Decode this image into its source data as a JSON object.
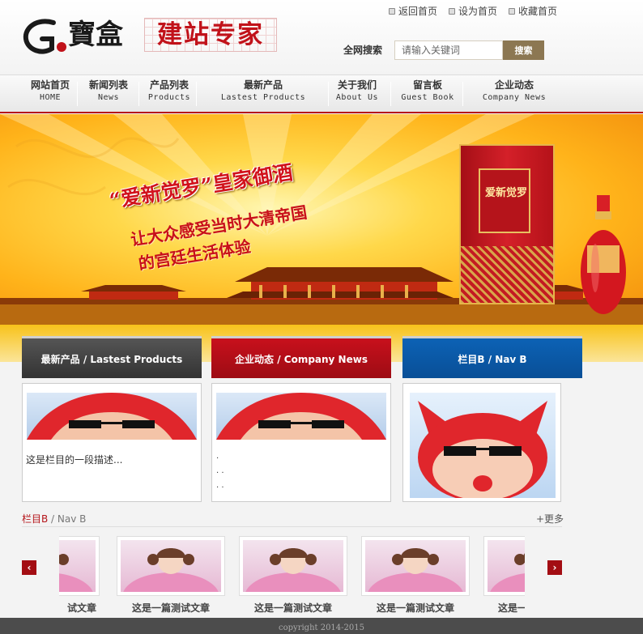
{
  "header": {
    "logo_text": "建站专家",
    "logo_brand": "G寶盒",
    "top_links": [
      {
        "label": "返回首页",
        "icon": "home-icon"
      },
      {
        "label": "设为首页",
        "icon": "home-icon"
      },
      {
        "label": "收藏首页",
        "icon": "home-icon"
      }
    ],
    "search": {
      "label": "全网搜索",
      "placeholder": "请输入关键词",
      "button": "搜索"
    }
  },
  "nav": [
    {
      "cn": "网站首页",
      "en": "HOME"
    },
    {
      "cn": "新闻列表",
      "en": "News"
    },
    {
      "cn": "产品列表",
      "en": "Products"
    },
    {
      "cn": "最新产品",
      "en": "Lastest Products"
    },
    {
      "cn": "关于我们",
      "en": "About Us"
    },
    {
      "cn": "留言板",
      "en": "Guest Book"
    },
    {
      "cn": "企业动态",
      "en": "Company News"
    }
  ],
  "banner": {
    "title": "“爱新觉罗”皇家御酒",
    "line1": "让大众感受当时大清帝国",
    "line2": "的宫廷生活体验",
    "product_label": "爱新觉罗"
  },
  "columns": [
    {
      "title": "最新产品 / Lastest Products",
      "desc": "这是栏目的一段描述..."
    },
    {
      "title": "企业动态 / Company News",
      "dots": [
        ".",
        ". .",
        ". ."
      ]
    },
    {
      "title": "栏目B / Nav B"
    }
  ],
  "section_b": {
    "title_a": "栏目B",
    "title_b": " / Nav B",
    "more": "+更多",
    "prev": "‹",
    "next": "›",
    "cards": [
      "试文章",
      "这是一篇测试文章",
      "这是一篇测试文章",
      "这是一篇测试文章",
      "这是一"
    ]
  },
  "footer": {
    "copyright": "copyright 2014-2015"
  },
  "colors": {
    "brand_red": "#b5161b",
    "search_btn": "#8c7752",
    "nav_blue": "#0c62b5",
    "dark_gray": "#4c4c4c"
  }
}
